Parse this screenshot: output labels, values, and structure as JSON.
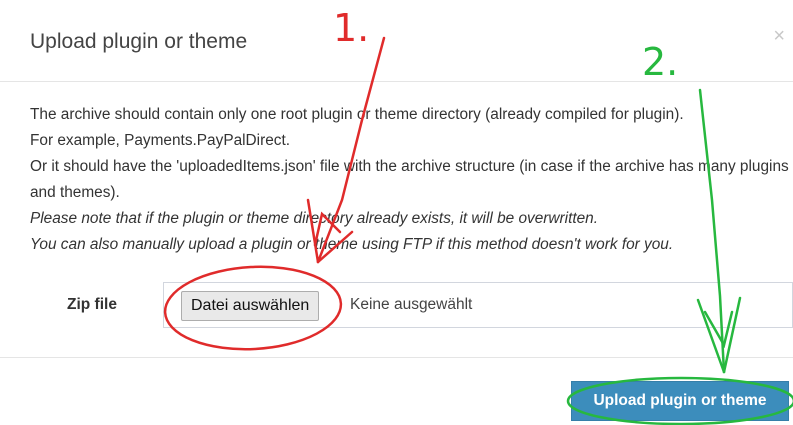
{
  "dialog": {
    "title": "Upload plugin or theme",
    "close_label": "×"
  },
  "description": {
    "line1": "The archive should contain only one root plugin or theme directory (already compiled for plugin).",
    "line2": "For example, Payments.PayPalDirect.",
    "line3": "Or it should have the 'uploadedItems.json' file with the archive structure (in case if the archive has many plugins and themes).",
    "note1": "Please note that if the plugin or theme directory already exists, it will be overwritten.",
    "note2": "You can also manually upload a plugin or theme using FTP if this method doesn't work for you."
  },
  "form": {
    "zip_label": "Zip file",
    "choose_button": "Datei auswählen",
    "no_file_text": "Keine ausgewählt"
  },
  "footer": {
    "submit_label": "Upload plugin or theme"
  },
  "annotations": {
    "step1": "1.",
    "step2": "2.",
    "step1_color": "#e02b2b",
    "step2_color": "#27b83f"
  }
}
